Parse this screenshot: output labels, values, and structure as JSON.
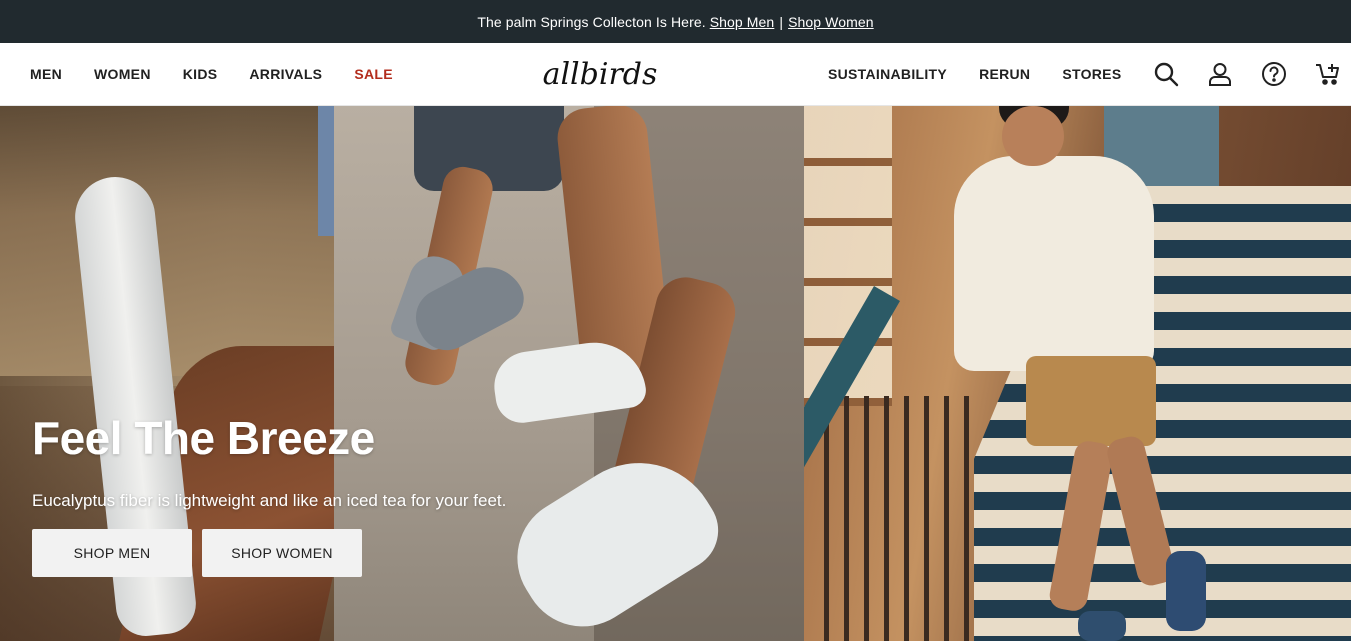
{
  "announcement": {
    "text": "The palm Springs Collecton Is Here.",
    "link_men": "Shop Men",
    "separator": "|",
    "link_women": "Shop Women"
  },
  "nav": {
    "left": [
      "MEN",
      "WOMEN",
      "KIDS",
      "ARRIVALS",
      "SALE"
    ],
    "logo": "allbirds",
    "right": [
      "SUSTAINABILITY",
      "RERUN",
      "STORES"
    ],
    "icons": [
      "search-icon",
      "account-icon",
      "help-icon",
      "cart-icon"
    ],
    "sale_color": "#b32d1d"
  },
  "hero": {
    "title": "Feel The Breeze",
    "subtitle": "Eucalyptus fiber is lightweight and like an iced tea for your feet.",
    "button_men": "SHOP MEN",
    "button_women": "SHOP WOMEN"
  },
  "colors": {
    "announcement_bg": "#212a2f",
    "button_bg": "#f2f2f2"
  }
}
